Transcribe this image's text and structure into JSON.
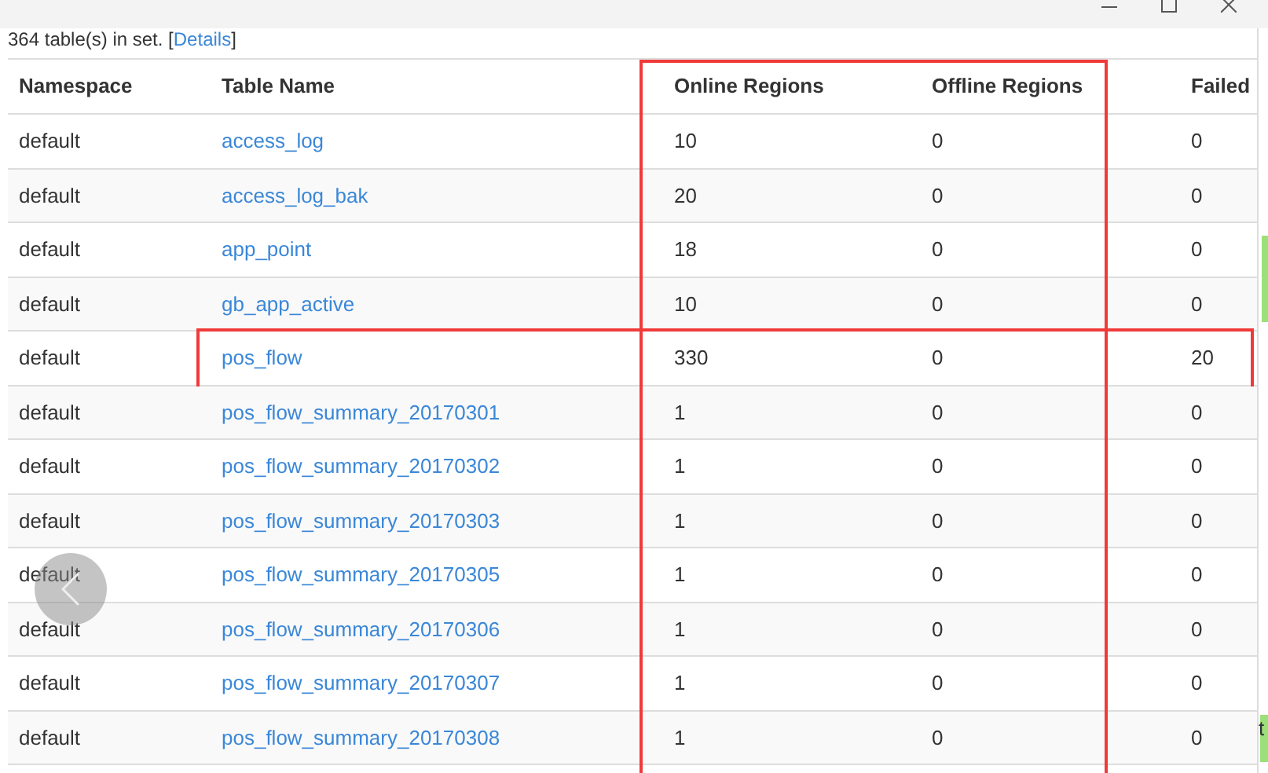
{
  "summary": {
    "prefix": "364 table(s) in set. [",
    "link": "Details",
    "suffix": "]"
  },
  "columns": [
    {
      "label": "Namespace",
      "highlighted": false
    },
    {
      "label": "Table Name",
      "highlighted": false
    },
    {
      "label": "Online Regions",
      "highlighted": true
    },
    {
      "label": "Offline Regions",
      "highlighted": true
    },
    {
      "label": "Failed",
      "highlighted": false
    }
  ],
  "rows": [
    {
      "namespace": "default",
      "table": "access_log",
      "online": "10",
      "offline": "0",
      "failed": "0",
      "highlighted": false
    },
    {
      "namespace": "default",
      "table": "access_log_bak",
      "online": "20",
      "offline": "0",
      "failed": "0",
      "highlighted": false
    },
    {
      "namespace": "default",
      "table": "app_point",
      "online": "18",
      "offline": "0",
      "failed": "0",
      "highlighted": false
    },
    {
      "namespace": "default",
      "table": "gb_app_active",
      "online": "10",
      "offline": "0",
      "failed": "0",
      "highlighted": false
    },
    {
      "namespace": "default",
      "table": "pos_flow",
      "online": "330",
      "offline": "0",
      "failed": "20",
      "highlighted": true
    },
    {
      "namespace": "default",
      "table": "pos_flow_summary_20170301",
      "online": "1",
      "offline": "0",
      "failed": "0",
      "highlighted": false
    },
    {
      "namespace": "default",
      "table": "pos_flow_summary_20170302",
      "online": "1",
      "offline": "0",
      "failed": "0",
      "highlighted": false
    },
    {
      "namespace": "default",
      "table": "pos_flow_summary_20170303",
      "online": "1",
      "offline": "0",
      "failed": "0",
      "highlighted": false
    },
    {
      "namespace": "default",
      "table": "pos_flow_summary_20170305",
      "online": "1",
      "offline": "0",
      "failed": "0",
      "highlighted": false
    },
    {
      "namespace": "default",
      "table": "pos_flow_summary_20170306",
      "online": "1",
      "offline": "0",
      "failed": "0",
      "highlighted": false
    },
    {
      "namespace": "default",
      "table": "pos_flow_summary_20170307",
      "online": "1",
      "offline": "0",
      "failed": "0",
      "highlighted": false
    },
    {
      "namespace": "default",
      "table": "pos_flow_summary_20170308",
      "online": "1",
      "offline": "0",
      "failed": "0",
      "highlighted": false
    }
  ],
  "edge_text": "t"
}
